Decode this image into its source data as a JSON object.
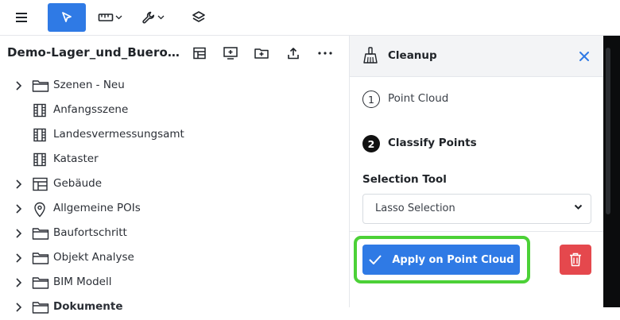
{
  "toolbar": {
    "menu_icon": "hamburger-icon",
    "select_icon": "cursor-icon",
    "measure_icon": "ruler-icon",
    "tools_icon": "wrench-icon",
    "layers_icon": "layers-icon",
    "accent_color": "#2f7ae5"
  },
  "project": {
    "title": "Demo-Lager_und_Buerogebäude",
    "actions": [
      "layout-icon",
      "add-screen-icon",
      "add-folder-icon",
      "upload-icon",
      "more-icon"
    ]
  },
  "tree": {
    "items": [
      {
        "label": "Szenen - Neu",
        "icon": "folder-icon",
        "expandable": true
      },
      {
        "label": "Anfangsszene",
        "icon": "film-icon",
        "expandable": false
      },
      {
        "label": "Landesvermessungsamt",
        "icon": "film-icon",
        "expandable": false
      },
      {
        "label": "Kataster",
        "icon": "film-icon",
        "expandable": false
      },
      {
        "label": "Gebäude",
        "icon": "layout-icon",
        "expandable": true
      },
      {
        "label": "Allgemeine POIs",
        "icon": "map-pin-icon",
        "expandable": true
      },
      {
        "label": "Baufortschritt",
        "icon": "folder-icon",
        "expandable": true
      },
      {
        "label": "Objekt Analyse",
        "icon": "folder-icon",
        "expandable": true
      },
      {
        "label": "BIM Modell",
        "icon": "folder-icon",
        "expandable": true
      },
      {
        "label": "Dokumente",
        "icon": "folder-icon",
        "expandable": true
      }
    ]
  },
  "cleanup_panel": {
    "title": "Cleanup",
    "icon": "broom-icon",
    "steps": [
      {
        "number": "1",
        "label": "Point Cloud",
        "active": false
      },
      {
        "number": "2",
        "label": "Classify Points",
        "active": true
      }
    ],
    "selection_tool": {
      "label": "Selection Tool",
      "value": "Lasso Selection"
    },
    "apply_label": "Apply on Point Cloud",
    "delete_icon": "trash-icon",
    "colors": {
      "apply": "#2f7ae5",
      "delete": "#e5484d",
      "highlight": "#4cd137"
    }
  }
}
